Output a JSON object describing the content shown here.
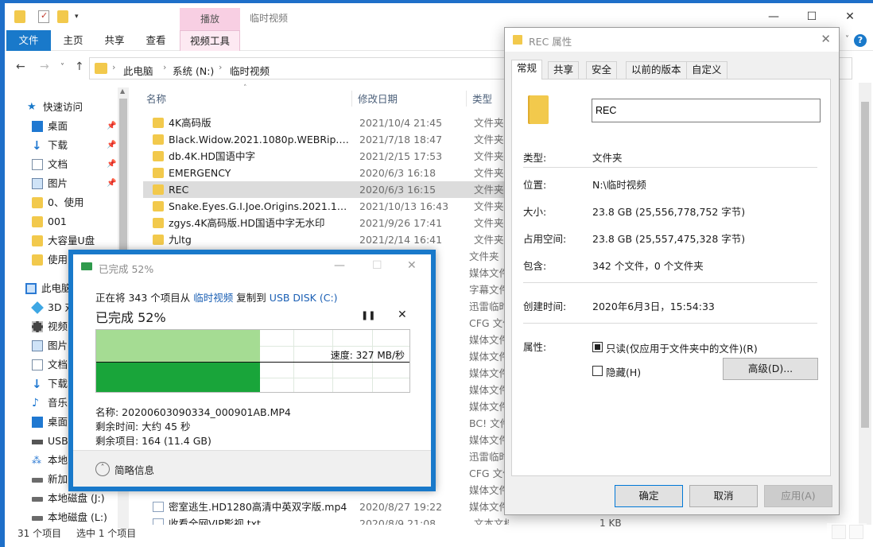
{
  "explorer": {
    "window_title": "临时视频",
    "contextual_tab_header": "播放",
    "ribbon_tabs": [
      "文件",
      "主页",
      "共享",
      "查看",
      "视频工具"
    ],
    "breadcrumb": [
      "此电脑",
      "系统 (N:)",
      "临时视频"
    ],
    "columns": {
      "name": "名称",
      "date": "修改日期",
      "type": "类型"
    },
    "nav": {
      "quick_access": "快速访问",
      "items": [
        "桌面",
        "下载",
        "文档",
        "图片",
        "0、使用",
        "001",
        "大容量U盘",
        "使用"
      ],
      "this_pc": "此电脑",
      "pc_items": [
        "3D 对",
        "视频",
        "图片",
        "文档",
        "下载",
        "音乐",
        "桌面",
        "USB",
        "本地",
        "新加",
        "本地磁盘 (J:)",
        "本地磁盘 (L:)"
      ]
    },
    "files": [
      {
        "name": "4K高码版",
        "date": "2021/10/4 21:45",
        "type": "文件夹"
      },
      {
        "name": "Black.Widow.2021.1080p.WEBRip.x26...",
        "date": "2021/7/18 18:47",
        "type": "文件夹"
      },
      {
        "name": "db.4K.HD国语中字",
        "date": "2021/2/15 17:53",
        "type": "文件夹"
      },
      {
        "name": "EMERGENCY",
        "date": "2020/6/3 16:18",
        "type": "文件夹"
      },
      {
        "name": "REC",
        "date": "2020/6/3 16:15",
        "type": "文件夹"
      },
      {
        "name": "Snake.Eyes.G.I.Joe.Origins.2021.1080...",
        "date": "2021/10/13 16:43",
        "type": "文件夹"
      },
      {
        "name": "zgys.4K高码版.HD国语中字无水印",
        "date": "2021/9/26 17:41",
        "type": "文件夹"
      },
      {
        "name": "九ltg",
        "date": "2021/2/14 16:41",
        "type": "文件夹"
      }
    ],
    "hidden_types": [
      "文件夹",
      "媒体文件",
      "字幕文件",
      "迅雷临时",
      "CFG 文件",
      "媒体文件",
      "媒体文件",
      "媒体文件",
      "媒体文件",
      "媒体文件",
      "BC! 文件",
      "媒体文件",
      "迅雷临时",
      "CFG 文件",
      "媒体文件",
      "媒体文件"
    ],
    "bottom_files": [
      {
        "name": "密室逃生.HD1280高清中英双字版.mp4",
        "date": "2020/8/27 19:22"
      },
      {
        "name": "收看全网VIP影视.txt",
        "date": "2020/8/9 21:08",
        "type": "文本文档",
        "size": "1 KB"
      }
    ],
    "status_left": "31 个项目",
    "status_selected": "选中 1 个项目"
  },
  "copy_dialog": {
    "title": "已完成 52%",
    "line_prefix": "正在将 343 个项目从",
    "source": "临时视频",
    "line_mid": "复制到",
    "dest": "USB DISK (C:)",
    "percent_text": "已完成 52%",
    "progress": 0.52,
    "speed": "速度: 327 MB/秒",
    "name": "名称: 20200603090334_000901AB.MP4",
    "remaining_time": "剩余时间: 大约 45 秒",
    "remaining_items": "剩余项目: 164 (11.4 GB)",
    "details_toggle": "简略信息"
  },
  "properties": {
    "title": "REC 属性",
    "tabs": [
      "常规",
      "共享",
      "安全",
      "以前的版本",
      "自定义"
    ],
    "folder_name": "REC",
    "type_label": "类型:",
    "type_value": "文件夹",
    "location_label": "位置:",
    "location_value": "N:\\临时视频",
    "size_label": "大小:",
    "size_value": "23.8 GB (25,556,778,752 字节)",
    "disk_size_label": "占用空间:",
    "disk_size_value": "23.8 GB (25,557,475,328 字节)",
    "contains_label": "包含:",
    "contains_value": "342 个文件，0 个文件夹",
    "created_label": "创建时间:",
    "created_value": "2020年6月3日，15:54:33",
    "attributes_label": "属性:",
    "readonly_label": "只读(仅应用于文件夹中的文件)(R)",
    "readonly_checked": true,
    "hidden_label": "隐藏(H)",
    "hidden_checked": false,
    "advanced_button": "高级(D)...",
    "ok_button": "确定",
    "cancel_button": "取消",
    "apply_button": "应用(A)"
  }
}
